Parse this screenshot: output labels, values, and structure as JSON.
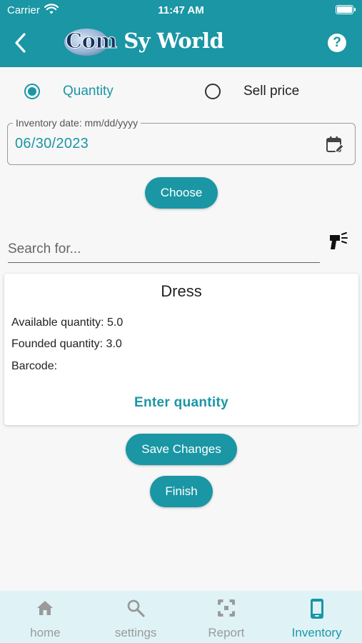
{
  "status_bar": {
    "carrier": "Carrier",
    "time": "11:47 AM"
  },
  "header": {
    "logo_part1": "Com",
    "logo_part2": "Sy",
    "logo_part3": "World",
    "back_icon": "chevron-left-icon",
    "help_icon": "help-circle-icon",
    "help_glyph": "?"
  },
  "mode": {
    "options": [
      {
        "label": "Quantity",
        "selected": true
      },
      {
        "label": "Sell price",
        "selected": false
      }
    ]
  },
  "inventory_date": {
    "label": "Inventory date: mm/dd/yyyy",
    "value": "06/30/2023",
    "icon": "calendar-edit-icon"
  },
  "choose_button": {
    "label": "Choose"
  },
  "search": {
    "placeholder": "Search for...",
    "scanner_icon": "barcode-scanner-icon"
  },
  "item_card": {
    "title": "Dress",
    "available_label": "Available quantity: 5.0",
    "founded_label": "Founded quantity: 3.0",
    "barcode_label": "Barcode:",
    "enter_quantity_label": "Enter quantity"
  },
  "save_button": {
    "label": "Save Changes"
  },
  "finish_button": {
    "label": "Finish"
  },
  "tabs": [
    {
      "label": "home",
      "icon": "home-icon",
      "active": false
    },
    {
      "label": "settings",
      "icon": "search-icon",
      "active": false
    },
    {
      "label": "Report",
      "icon": "report-icon",
      "active": false
    },
    {
      "label": "Inventory",
      "icon": "phone-icon",
      "active": true
    }
  ],
  "colors": {
    "accent": "#1a96a4",
    "tabbar_bg": "#dff3f7",
    "page_bg": "#f7f7f7",
    "inactive": "#9a9a9a"
  }
}
